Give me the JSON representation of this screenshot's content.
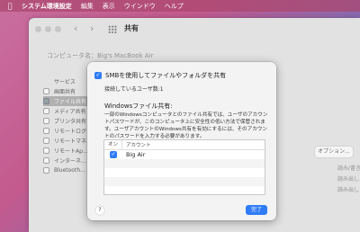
{
  "menubar": {
    "apple_icon": "apple-icon",
    "app_name": "システム環境設定",
    "items": [
      "編集",
      "表示",
      "ウインドウ",
      "ヘルプ"
    ]
  },
  "window": {
    "title": "共有",
    "computer_name": "コンピュータ名：Big's MacBook Air",
    "services": [
      "サービス",
      "画面共有",
      "ファイル共有",
      "メディア共有",
      "プリンタ共有",
      "リモートログイン",
      "リモートマネ...",
      "リモートAp...",
      "インターネ...",
      "Bluetooth..."
    ],
    "options_label": "オプション...",
    "right_labels": [
      "読み/書き",
      "読み出し",
      "読み出し"
    ]
  },
  "sheet": {
    "smb_label": "SMBを使用してファイルやフォルダを共有",
    "smb_checked": true,
    "connected_users": "接続しているユーザ数:1",
    "windows_title": "Windowsファイル共有:",
    "description": "一部のWindowsコンピュータとのファイル共有では、ユーザのアカウントパスワードが、このコンピュータ上に安全性の低い方法で保管されます。ユーザアカウントのWindows共有を有効にするには、そのアカウントのパスワードを入力する必要があります。",
    "table": {
      "col_on": "オン",
      "col_account": "アカウント",
      "rows": [
        {
          "on": true,
          "account": "Big Air"
        }
      ]
    },
    "help_label": "?",
    "done_label": "完了"
  },
  "colors": {
    "accent": "#2f7cf6"
  }
}
